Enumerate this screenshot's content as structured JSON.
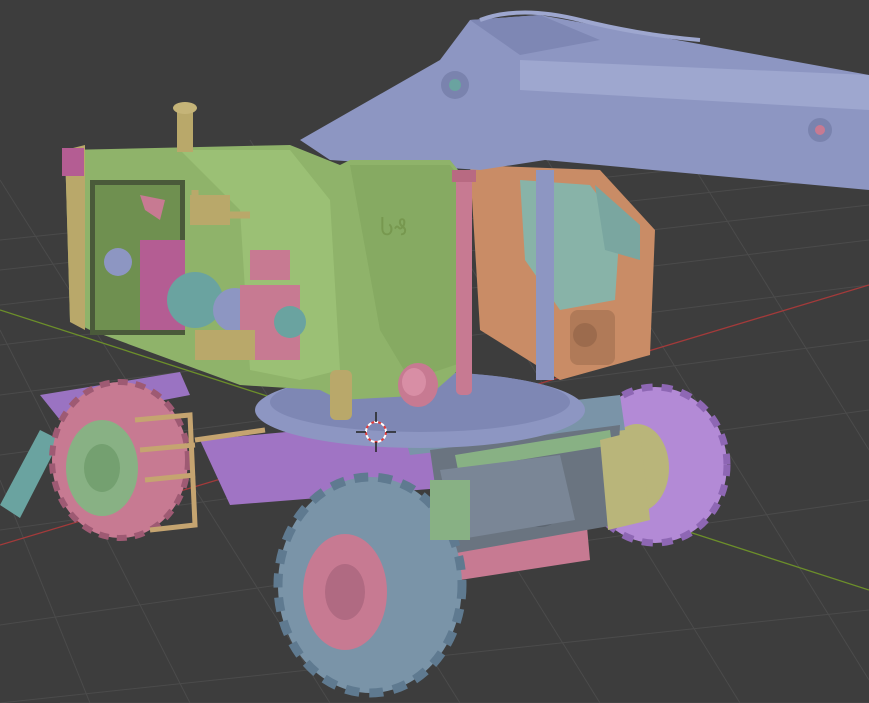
{
  "viewport": {
    "background": "#3d3d3d",
    "grid_color": "#4a4a4a",
    "x_axis_color": "#a33a3a",
    "y_axis_color": "#6c8f2a",
    "cursor_colors": [
      "#e23c3c",
      "#ffffff"
    ]
  },
  "model": {
    "palette": {
      "cab_green": "#8fb36a",
      "cab_shadow": "#6f9050",
      "boom_blue": "#8d96c2",
      "boom_shadow": "#6e76a3",
      "frame_tan": "#b9a86a",
      "pink": "#c77a92",
      "magenta": "#b45d93",
      "purple": "#9a73c2",
      "orange_cab": "#c98c66",
      "tire_blue": "#7a94a8",
      "tire_pink": "#c77a92",
      "tire_purple": "#b38ad6",
      "hub_green": "#88b184",
      "hub_olive": "#b9b57a",
      "teal": "#6aa3a0",
      "axle_dark": "#6a7480"
    },
    "decal_text": "Ⴑ₰"
  }
}
